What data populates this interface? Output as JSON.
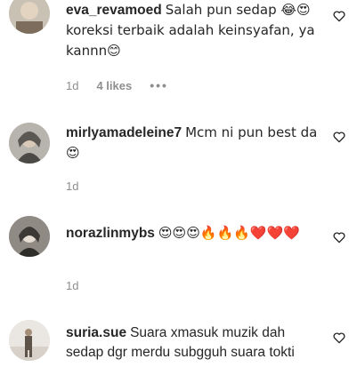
{
  "comments": [
    {
      "username": "eva_revamoed",
      "text": "Salah pun sedap 😂😍 koreksi terbaik adalah keinsyafan, ya kannn😊",
      "age": "1d",
      "likes": "4 likes",
      "more": "•••"
    },
    {
      "username": "mirlyamadeleine7",
      "text": "Mcm ni pun best da😍",
      "age": "1d"
    },
    {
      "username": "norazlinmybs",
      "text": "😍😍😍🔥🔥🔥❤️❤️❤️",
      "age": "1d"
    },
    {
      "username": "suria.sue",
      "text": "Suara xmasuk muzik dah sedap dgr merdu subgguh suara tokti"
    }
  ],
  "icons": {
    "like": "heart-outline-icon",
    "options": "more-horizontal-icon"
  },
  "colors": {
    "text": "#262626",
    "secondary": "#8e8e8e",
    "background": "#ffffff"
  }
}
